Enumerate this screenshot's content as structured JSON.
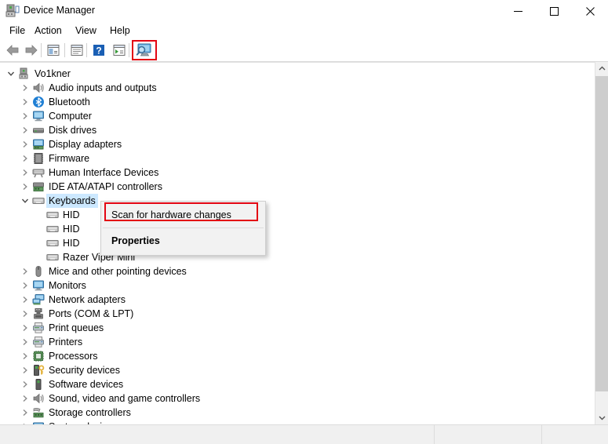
{
  "window": {
    "title": "Device Manager",
    "title_icon": "device-manager-icon",
    "controls": {
      "minimize": "minimize-icon",
      "maximize": "maximize-icon",
      "close": "close-icon"
    }
  },
  "menubar": {
    "items": [
      {
        "label": "File"
      },
      {
        "label": "Action"
      },
      {
        "label": "View"
      },
      {
        "label": "Help"
      }
    ]
  },
  "toolbar": {
    "buttons": [
      {
        "name": "back-arrow-icon",
        "tooltip": "Back"
      },
      {
        "name": "forward-arrow-icon",
        "tooltip": "Forward"
      },
      {
        "name": "show-hide-console-tree-icon",
        "tooltip": "Show/Hide Console Tree"
      },
      {
        "name": "properties-icon",
        "tooltip": "Properties"
      },
      {
        "name": "help-icon",
        "tooltip": "Help"
      },
      {
        "name": "update-driver-icon",
        "tooltip": "Update driver"
      },
      {
        "name": "scan-for-hardware-changes-icon",
        "tooltip": "Scan for hardware changes"
      }
    ],
    "highlighted_button": "scan-for-hardware-changes-icon",
    "highlight_color": "#e30613"
  },
  "tree": {
    "root": {
      "label": "Vo1kner",
      "icon": "computer-node-icon",
      "expanded": true
    },
    "items": [
      {
        "label": "Audio inputs and outputs",
        "icon": "speaker-icon",
        "expanded": false,
        "indent": 1
      },
      {
        "label": "Bluetooth",
        "icon": "bluetooth-icon",
        "expanded": false,
        "indent": 1
      },
      {
        "label": "Computer",
        "icon": "monitor-icon",
        "expanded": false,
        "indent": 1
      },
      {
        "label": "Disk drives",
        "icon": "disk-drive-icon",
        "expanded": false,
        "indent": 1
      },
      {
        "label": "Display adapters",
        "icon": "display-adapter-icon",
        "expanded": false,
        "indent": 1
      },
      {
        "label": "Firmware",
        "icon": "firmware-chip-icon",
        "expanded": false,
        "indent": 1
      },
      {
        "label": "Human Interface Devices",
        "icon": "hid-icon",
        "expanded": false,
        "indent": 1
      },
      {
        "label": "IDE ATA/ATAPI controllers",
        "icon": "ide-controller-icon",
        "expanded": false,
        "indent": 1
      },
      {
        "label": "Keyboards",
        "icon": "keyboard-icon",
        "expanded": true,
        "indent": 1,
        "selected": true
      },
      {
        "label": "HID",
        "icon": "keyboard-icon",
        "indent": 2,
        "leaf": true
      },
      {
        "label": "HID",
        "icon": "keyboard-icon",
        "indent": 2,
        "leaf": true
      },
      {
        "label": "HID",
        "icon": "keyboard-icon",
        "indent": 2,
        "leaf": true
      },
      {
        "label": "Razer Viper Mini",
        "icon": "keyboard-icon",
        "indent": 2,
        "leaf": true
      },
      {
        "label": "Mice and other pointing devices",
        "icon": "mouse-icon",
        "expanded": false,
        "indent": 1
      },
      {
        "label": "Monitors",
        "icon": "monitor-icon",
        "expanded": false,
        "indent": 1
      },
      {
        "label": "Network adapters",
        "icon": "network-adapter-icon",
        "expanded": false,
        "indent": 1
      },
      {
        "label": "Ports (COM & LPT)",
        "icon": "port-icon",
        "expanded": false,
        "indent": 1
      },
      {
        "label": "Print queues",
        "icon": "printer-icon",
        "expanded": false,
        "indent": 1
      },
      {
        "label": "Printers",
        "icon": "printer-icon",
        "expanded": false,
        "indent": 1
      },
      {
        "label": "Processors",
        "icon": "processor-icon",
        "expanded": false,
        "indent": 1
      },
      {
        "label": "Security devices",
        "icon": "security-device-icon",
        "expanded": false,
        "indent": 1
      },
      {
        "label": "Software devices",
        "icon": "software-device-icon",
        "expanded": false,
        "indent": 1
      },
      {
        "label": "Sound, video and game controllers",
        "icon": "speaker-icon",
        "expanded": false,
        "indent": 1
      },
      {
        "label": "Storage controllers",
        "icon": "storage-controller-icon",
        "expanded": false,
        "indent": 1
      },
      {
        "label": "System devices",
        "icon": "system-device-icon",
        "expanded": false,
        "indent": 1
      }
    ],
    "selection_color": "#cce8ff"
  },
  "context_menu": {
    "items": [
      {
        "label": "Scan for hardware changes",
        "bold": false,
        "highlighted": true
      },
      {
        "label": "Properties",
        "bold": true,
        "highlighted": false
      }
    ],
    "highlight_color": "#e30613"
  },
  "scrollbar": {
    "up_arrow": "chevron-up-icon",
    "down_arrow": "chevron-down-icon"
  },
  "statusbar": {
    "text": ""
  }
}
